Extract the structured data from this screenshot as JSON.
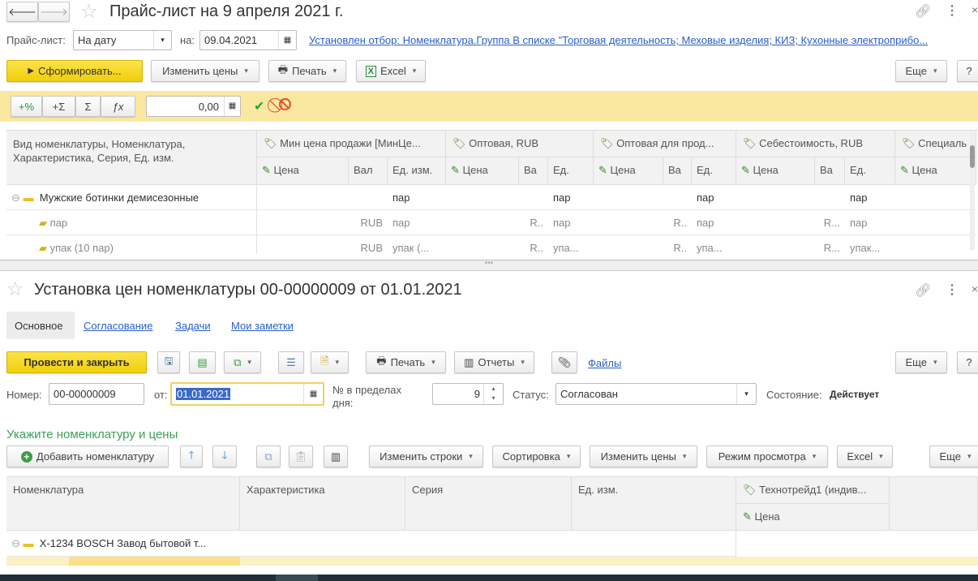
{
  "window1": {
    "title": "Прайс-лист на 9 апреля 2021 г.",
    "price_list_label": "Прайс-лист:",
    "price_list_value": "На дату",
    "on_label": "на:",
    "date_value": "09.04.2021",
    "filter_link": "Установлен отбор: Номенклатура.Группа В списке \"Торговая деятельность; Меховые изделия; КИЗ; Кухонные электроприбо...",
    "toolbar": {
      "generate": "Сформировать...",
      "change_prices": "Изменить цены",
      "print": "Печать",
      "excel": "Excel",
      "more": "Еще",
      "help": "?"
    },
    "edit_bar": {
      "plus_percent": "+%",
      "plus_sum": "+Σ",
      "sum": "Σ",
      "fx": "ƒx",
      "value": "0,00"
    },
    "table": {
      "first_header": "Вид номенклатуры, Номенклатура, Характеристика, Серия, Ед. изм.",
      "groups": [
        "Мин цена продажи [МинЦе...",
        "Оптовая, RUB",
        "Оптовая для прод...",
        "Себестоимость, RUB",
        "Специаль"
      ],
      "sub_headers": {
        "price": "Цена",
        "cur_full": "Вал",
        "cur_short": "Ва",
        "unit_full": "Ед. изм.",
        "unit_short": "Ед."
      },
      "rows": [
        {
          "name": "Мужские ботинки демисезонные",
          "cells": [
            "",
            "",
            "пар",
            "",
            "",
            "пар",
            "",
            "",
            "пар",
            "",
            "",
            "пар",
            ""
          ]
        },
        {
          "name": "пар",
          "cells": [
            "",
            "RUB",
            "пар",
            "",
            "R..",
            "пар",
            "",
            "R..",
            "пар",
            "",
            "R...",
            "пар",
            ""
          ]
        },
        {
          "name": "упак (10 пар)",
          "cells": [
            "",
            "RUB",
            "упак (...",
            "",
            "R..",
            "упа...",
            "",
            "R..",
            "упа...",
            "",
            "R...",
            "упак...",
            ""
          ]
        }
      ]
    }
  },
  "window2": {
    "title": "Установка цен номенклатуры 00-00000009 от 01.01.2021",
    "tabs": [
      "Основное",
      "Согласование",
      "Задачи",
      "Мои заметки"
    ],
    "toolbar": {
      "post_close": "Провести и закрыть",
      "print": "Печать",
      "reports": "Отчеты",
      "files": "Файлы",
      "more": "Еще",
      "help": "?"
    },
    "form": {
      "number_label": "Номер:",
      "number": "00-00000009",
      "from_label": "от:",
      "date": "01.01.2021",
      "day_no_label": "№ в пределах дня:",
      "day_no": "9",
      "status_label": "Статус:",
      "status": "Согласован",
      "state_label": "Состояние:",
      "state": "Действует"
    },
    "section_title": "Укажите номенклатуру и цены",
    "table_toolbar": {
      "add": "Добавить номенклатуру",
      "change_rows": "Изменить строки",
      "sort": "Сортировка",
      "change_prices": "Изменить цены",
      "view_mode": "Режим просмотра",
      "excel": "Excel",
      "more": "Еще"
    },
    "table": {
      "headers": [
        "Номенклатура",
        "Характеристика",
        "Серия",
        "Ед. изм.",
        "Технотрейд1 (индив..."
      ],
      "price_sub": "Цена",
      "group_row": "X-1234 BOSCH Завод бытовой т..."
    }
  }
}
